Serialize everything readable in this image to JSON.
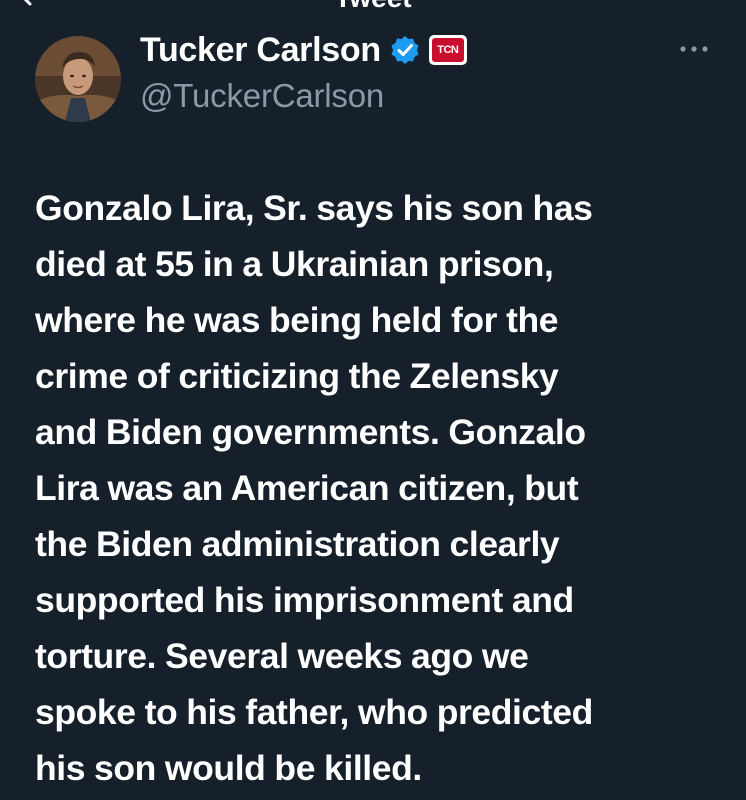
{
  "header": {
    "title": "Tweet"
  },
  "author": {
    "display_name": "Tucker Carlson",
    "handle": "@TuckerCarlson",
    "affiliate_badge_text": "TCN",
    "verified_color": "#1d9bf0",
    "badge_color": "#c8102e"
  },
  "tweet": {
    "lines": [
      "Gonzalo Lira, Sr. says his son has",
      "died at 55 in a Ukrainian prison,",
      "where he was being held for the",
      "crime of criticizing the Zelensky",
      "and Biden governments. Gonzalo",
      "Lira was an American citizen, but",
      "the Biden administration clearly",
      "supported his imprisonment and",
      "torture. Several weeks ago we",
      "spoke to his father, who predicted",
      "his son would be killed."
    ]
  },
  "theme": {
    "background": "#15202b",
    "text": "#ffffff",
    "secondary_text": "#8b98a5"
  }
}
